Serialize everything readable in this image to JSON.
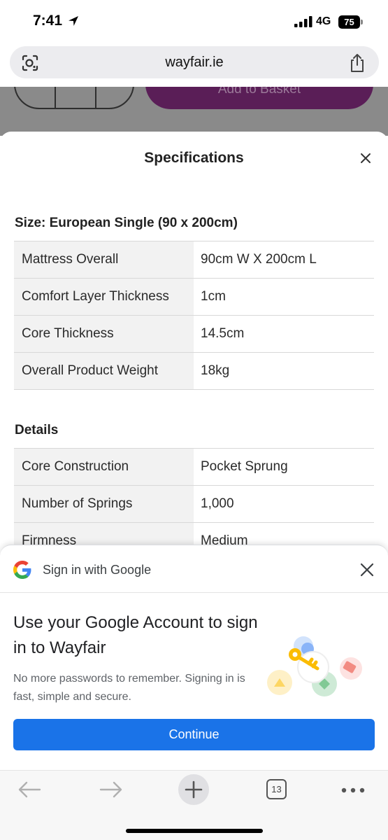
{
  "status_bar": {
    "time": "7:41",
    "network": "4G",
    "battery": "75"
  },
  "browser": {
    "domain": "wayfair.ie",
    "tab_count": "13"
  },
  "background_page": {
    "add_to_basket_label": "Add to Basket"
  },
  "specifications": {
    "title": "Specifications",
    "size_section": {
      "heading": "Size: European Single (90 x 200cm)",
      "rows": [
        {
          "key": "Mattress Overall",
          "value": "90cm W X 200cm L"
        },
        {
          "key": "Comfort Layer Thickness",
          "value": "1cm"
        },
        {
          "key": "Core Thickness",
          "value": "14.5cm"
        },
        {
          "key": "Overall Product Weight",
          "value": "18kg"
        }
      ]
    },
    "details_section": {
      "heading": "Details",
      "rows": [
        {
          "key": "Core Construction",
          "value": "Pocket Sprung"
        },
        {
          "key": "Number of Springs",
          "value": "1,000"
        },
        {
          "key": "Firmness",
          "value": "Medium"
        }
      ]
    }
  },
  "google_signin": {
    "header": "Sign in with Google",
    "title": "Use your Google Account to sign in to Wayfair",
    "subtitle": "No more passwords to remember. Signing in is fast, simple and secure.",
    "continue_label": "Continue"
  },
  "colors": {
    "google_blue": "#1a73e8",
    "wayfair_purple": "#7b2a76"
  }
}
